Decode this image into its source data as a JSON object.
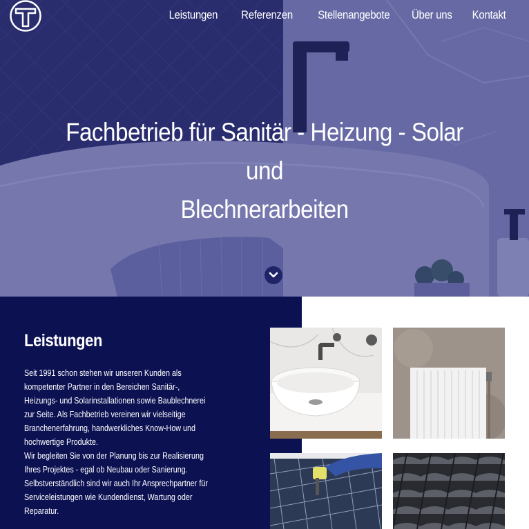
{
  "header": {
    "logo_alt": "T",
    "nav": [
      "Leistungen",
      "Referenzen",
      "Stellenangebote",
      "Über uns",
      "Kontakt"
    ]
  },
  "hero": {
    "title_line1": "Fachbetrieb für Sanitär - Heizung - Solar und",
    "title_line2": "Blechnerarbeiten",
    "scroll_icon": "chevron-down-icon"
  },
  "leistungen": {
    "title": "Leistungen",
    "paragraph1": "Seit 1991 schon stehen wir unseren Kunden als kompetenter Partner in den Bereichen Sanitär-, Heizungs- und Solarinstallationen sowie Baublechnerei zur Seite. Als Fachbetrieb vereinen wir vielseitige Branchenerfahrung, handwerkliches Know-How und hochwertige Produkte.",
    "paragraph2": "Wir begleiten Sie von der Planung bis zur Realisierung Ihres Projektes - egal ob Neubau oder Sanierung. Selbstverständlich sind wir auch Ihr Ansprechpartner für Serviceleistungen wie Kundendienst, Wartung oder Reparatur."
  },
  "tiles": [
    "washbasin-image",
    "radiator-image",
    "solar-panel-image",
    "roof-tiles-image"
  ],
  "colors": {
    "navy": "#0c1152",
    "hero_tint": "#6d71a4",
    "white": "#ffffff"
  }
}
